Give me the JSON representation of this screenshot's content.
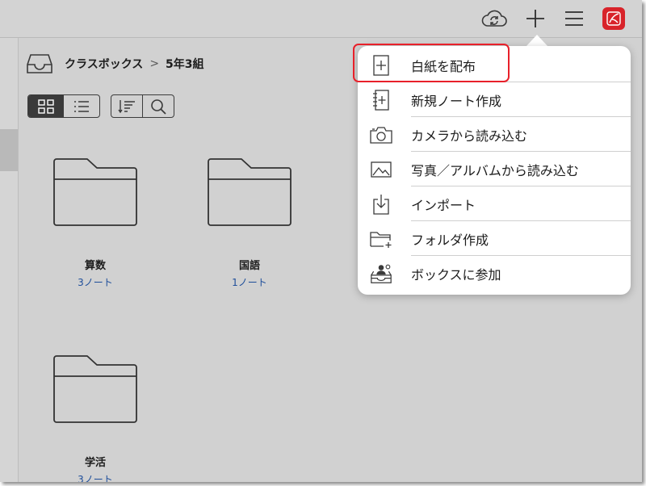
{
  "breadcrumb": {
    "root": "クラスボックス",
    "separator": ">",
    "current": "5年3組"
  },
  "toolbar": {
    "icons": [
      "cloud-sync-icon",
      "plus-icon",
      "hamburger-menu-icon",
      "app-logo-icon"
    ],
    "app_color": "#d8232a"
  },
  "view_controls": {
    "icons": [
      "grid-view-icon",
      "list-view-icon",
      "sort-icon",
      "search-icon"
    ]
  },
  "folders": [
    {
      "name": "算数",
      "count": "3ノート"
    },
    {
      "name": "国語",
      "count": "1ノート"
    },
    {
      "name": "学活",
      "count": "3ノート"
    }
  ],
  "menu": {
    "items": [
      {
        "label": "白紙を配布",
        "icon": "blank-page-plus-icon"
      },
      {
        "label": "新規ノート作成",
        "icon": "notebook-plus-icon"
      },
      {
        "label": "カメラから読み込む",
        "icon": "camera-icon"
      },
      {
        "label": "写真／アルバムから読み込む",
        "icon": "photo-icon"
      },
      {
        "label": "インポート",
        "icon": "import-icon"
      },
      {
        "label": "フォルダ作成",
        "icon": "folder-plus-icon"
      },
      {
        "label": "ボックスに参加",
        "icon": "join-box-icon"
      }
    ],
    "highlighted_item": "白紙を配布",
    "highlight_color": "#e8202a"
  },
  "colors": {
    "background": "#d1d1d1",
    "link": "#1e4e9a"
  }
}
